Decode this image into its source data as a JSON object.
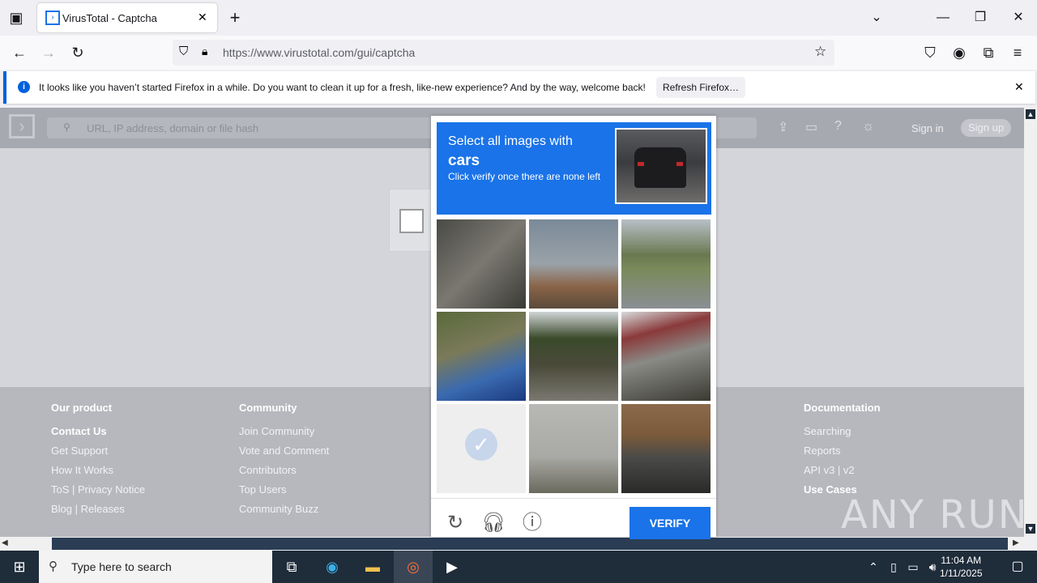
{
  "browser": {
    "tab_title": "VirusTotal - Captcha",
    "url": "https://www.virustotal.com/gui/captcha",
    "notification_text": "It looks like you haven’t started Firefox in a while. Do you want to clean it up for a fresh, like-new experience? And by the way, welcome back!",
    "notification_button": "Refresh Firefox…"
  },
  "vt": {
    "search_placeholder": "URL, IP address, domain or file hash",
    "sign_in": "Sign in",
    "sign_up": "Sign up",
    "footer": {
      "our_product": {
        "title": "Our product",
        "items": [
          "Contact Us",
          "Get Support",
          "How It Works",
          "ToS | Privacy Notice",
          "Blog | Releases"
        ]
      },
      "community": {
        "title": "Community",
        "items": [
          "Join Community",
          "Vote and Comment",
          "Contributors",
          "Top Users",
          "Community Buzz"
        ]
      },
      "documentation": {
        "title": "Documentation",
        "items": [
          "Searching",
          "Reports",
          "API v3 | v2",
          "Use Cases"
        ]
      }
    }
  },
  "captcha": {
    "line1": "Select all images with",
    "line2": "cars",
    "line3": "Click verify once there are none left",
    "verify": "VERIFY"
  },
  "taskbar": {
    "search": "Type here to search",
    "time": "11:04 AM",
    "date": "1/11/2025"
  },
  "watermark": "ANY RUN",
  "colors": {
    "accent": "#1a73e8",
    "firefox_blue": "#0060df",
    "taskbar": "#1f2c3a"
  }
}
